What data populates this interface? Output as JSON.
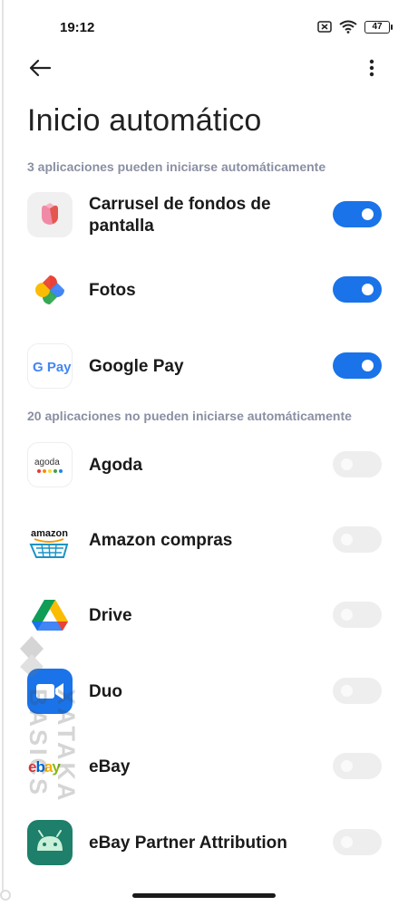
{
  "status_bar": {
    "time": "19:12",
    "battery": "47"
  },
  "header": {
    "title": "Inicio automático"
  },
  "sections": [
    {
      "label": "3 aplicaciones pueden iniciarse automáticamente"
    },
    {
      "label": "20 aplicaciones no pueden iniciarse automáticamente"
    }
  ],
  "apps": [
    {
      "name": "Carrusel de fondos de pantalla",
      "icon": "wallpaper-carousel-icon",
      "enabled": true
    },
    {
      "name": "Fotos",
      "icon": "google-photos-icon",
      "enabled": true
    },
    {
      "name": "Google Pay",
      "icon": "google-pay-icon",
      "icon_text": "G Pay",
      "enabled": true
    },
    {
      "name": "Agoda",
      "icon": "agoda-icon",
      "icon_text": "agoda",
      "enabled": false
    },
    {
      "name": "Amazon compras",
      "icon": "amazon-icon",
      "icon_text": "amazon",
      "enabled": false
    },
    {
      "name": "Drive",
      "icon": "google-drive-icon",
      "enabled": false
    },
    {
      "name": "Duo",
      "icon": "google-duo-icon",
      "enabled": false
    },
    {
      "name": "eBay",
      "icon": "ebay-icon",
      "enabled": false
    },
    {
      "name": "eBay Partner Attribution",
      "icon": "android-icon",
      "enabled": false
    }
  ],
  "watermark": {
    "text": "XATAKA BASICS"
  },
  "colors": {
    "toggle_on": "#1a73e8",
    "toggle_off": "#eeeeee",
    "section_text": "#8a8fa3"
  }
}
